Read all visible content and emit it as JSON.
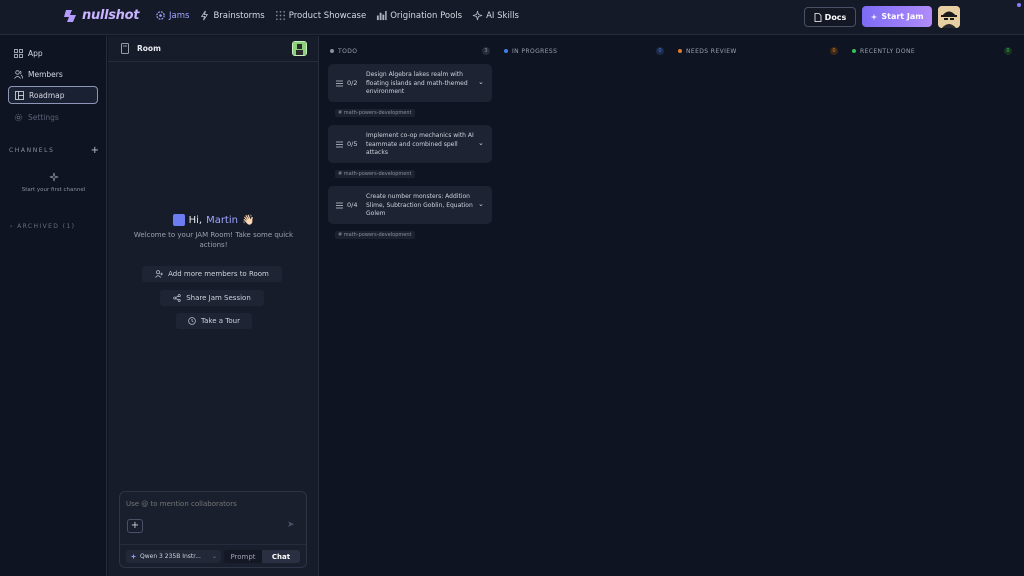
{
  "app": {
    "brand": "nullshot"
  },
  "nav": [
    {
      "label": "Jams",
      "icon": "jams-icon"
    },
    {
      "label": "Brainstorms",
      "icon": "bolt-icon"
    },
    {
      "label": "Product Showcase",
      "icon": "grid-icon"
    },
    {
      "label": "Origination Pools",
      "icon": "chart-icon"
    },
    {
      "label": "AI Skills",
      "icon": "sparkle-icon"
    }
  ],
  "header": {
    "docs_label": "Docs",
    "start_jam_label": "Start Jam"
  },
  "sidebar": {
    "items": [
      {
        "label": "App"
      },
      {
        "label": "Members"
      },
      {
        "label": "Roadmap"
      },
      {
        "label": "Settings"
      }
    ],
    "channels_heading": "CHANNELS",
    "channels_empty": "Start your first channel",
    "archived_label": "ARCHIVED",
    "archived_count": "(1)"
  },
  "room": {
    "title": "Room",
    "greeting_prefix": "Hi,",
    "greeting_name": "Martin",
    "greeting_emoji": "👋🏻",
    "welcome_text": "Welcome to your JAM Room! Take some quick actions!",
    "actions": [
      {
        "label": "Add more members to Room"
      },
      {
        "label": "Share Jam Session"
      },
      {
        "label": "Take a Tour"
      }
    ],
    "composer": {
      "placeholder": "Use @ to mention collaborators",
      "model": "Qwen 3 235B Instr...",
      "mode_prompt": "Prompt",
      "mode_chat": "Chat"
    }
  },
  "board": {
    "columns": [
      {
        "label": "TODO",
        "count": "3",
        "color": "#8a8f9c"
      },
      {
        "label": "IN PROGRESS",
        "count": "0",
        "color": "#3f7fe6"
      },
      {
        "label": "NEEDS REVIEW",
        "count": "0",
        "color": "#e27a2e"
      },
      {
        "label": "RECENTLY DONE",
        "count": "0",
        "color": "#34c05a"
      }
    ],
    "cards": [
      {
        "progress": "0/2",
        "text": "Design Algebra lakes realm with floating islands and math-themed environment",
        "tag": "# math-powers-development"
      },
      {
        "progress": "0/5",
        "text": "Implement co-op mechanics with AI teammate and combined spell attacks",
        "tag": "# math-powers-development"
      },
      {
        "progress": "0/4",
        "text": "Create number monsters: Addition Slime, Subtraction Goblin, Equation Golem",
        "tag": "# math-powers-development"
      }
    ]
  }
}
